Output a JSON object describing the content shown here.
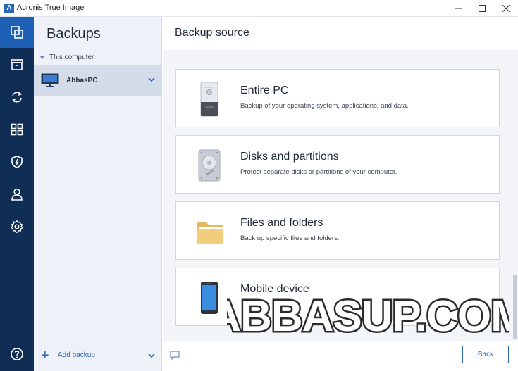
{
  "window": {
    "title": "Acronis True Image",
    "logo_letter": "A",
    "minimize_icon": "minimize-icon",
    "maximize_icon": "maximize-icon",
    "close_icon": "close-icon"
  },
  "rail": {
    "items": [
      {
        "icon": "backup-copy-icon",
        "active": true
      },
      {
        "icon": "archive-icon",
        "active": false
      },
      {
        "icon": "sync-icon",
        "active": false
      },
      {
        "icon": "tools-grid-icon",
        "active": false
      },
      {
        "icon": "shield-icon",
        "active": false
      },
      {
        "icon": "account-icon",
        "active": false
      },
      {
        "icon": "settings-icon",
        "active": false
      }
    ],
    "help_icon": "help-icon"
  },
  "panel": {
    "title": "Backups",
    "group_label": "This computer",
    "pc_name": "AbbasPC",
    "add_backup": "Add backup"
  },
  "main": {
    "title": "Backup source",
    "options": [
      {
        "title": "Entire PC",
        "desc": "Backup of your operating system, applications, and data.",
        "icon": "pc-tower-icon"
      },
      {
        "title": "Disks and partitions",
        "desc": "Protect separate disks or partitions of your computer.",
        "icon": "hard-disk-icon"
      },
      {
        "title": "Files and folders",
        "desc": "Back up specific files and folders.",
        "icon": "folder-icon"
      },
      {
        "title": "Mobile device",
        "desc": "",
        "icon": "mobile-phone-icon"
      }
    ],
    "back_label": "Back"
  },
  "watermark": {
    "text": "ABBASUP.COM"
  },
  "colors": {
    "rail_bg": "#0f2d55",
    "rail_active": "#1d5fb4",
    "accent": "#2a66b8",
    "panel_bg": "#eef1f7",
    "selected_row": "#d4dcea"
  }
}
